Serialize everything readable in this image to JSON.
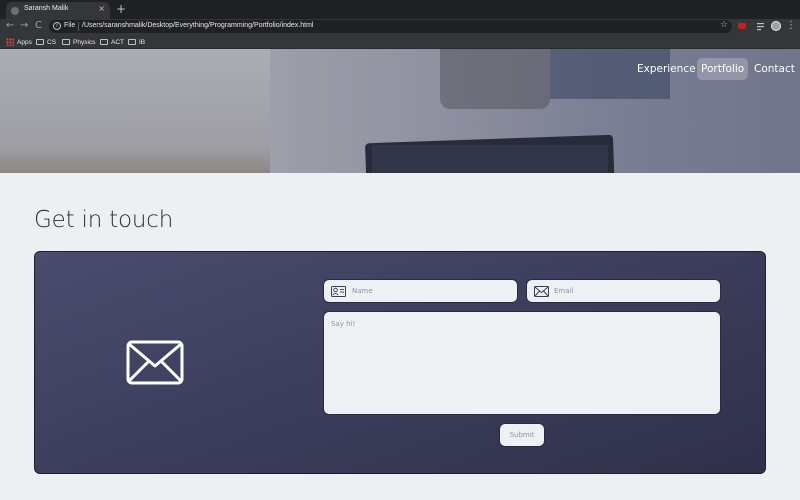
{
  "browser": {
    "tab_title": "Saransh Malik",
    "tab_close": "×",
    "new_tab": "+",
    "nav": {
      "back": "←",
      "forward": "→",
      "reload": "C"
    },
    "info_icon": "i",
    "scheme_label": "File",
    "url": "/Users/saranshmalik/Desktop/Everything/Programming/Portfolio/index.html",
    "star": "☆",
    "kebab": "⋮",
    "bookmarks": [
      {
        "label": "Apps",
        "icon": "apps-grid-icon"
      },
      {
        "label": "CS",
        "icon": "folder-icon"
      },
      {
        "label": "Physics",
        "icon": "folder-icon"
      },
      {
        "label": "ACT",
        "icon": "folder-icon"
      },
      {
        "label": "IB",
        "icon": "folder-icon"
      }
    ]
  },
  "nav": {
    "links": [
      {
        "label": "Experience",
        "active": false
      },
      {
        "label": "Portfolio",
        "active": true
      },
      {
        "label": "Contact",
        "active": false
      }
    ]
  },
  "contact": {
    "heading": "Get in touch",
    "name_placeholder": "Name",
    "email_placeholder": "Email",
    "message_placeholder": "Say hi!",
    "submit_label": "Submit",
    "icon": "envelope-icon"
  },
  "colors": {
    "page_bg": "#ecf0f3",
    "card_bg": "#3d3f5e",
    "field_bg": "#edf1f4"
  }
}
